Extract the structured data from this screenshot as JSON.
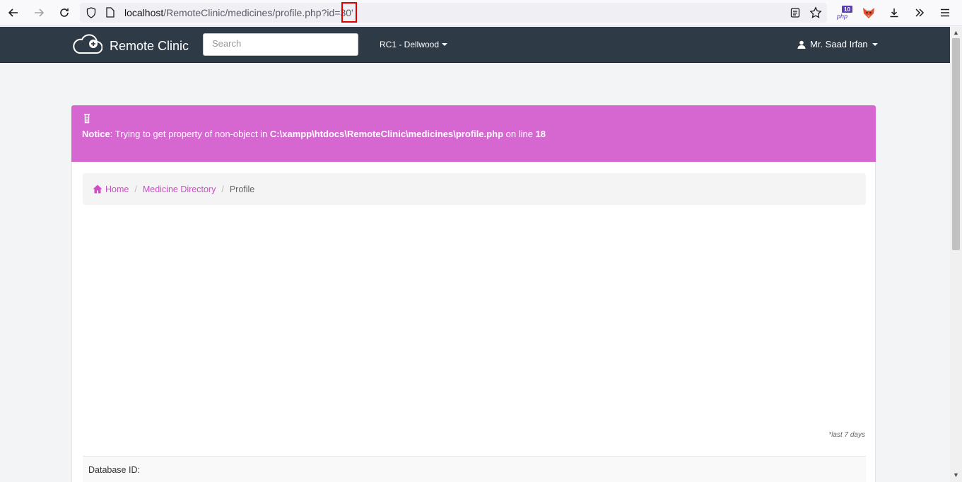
{
  "browser": {
    "url_host": "localhost",
    "url_path": "/RemoteClinic/medicines/profile.php?id=30'",
    "extension_badge": "10"
  },
  "navbar": {
    "brand": "Remote Clinic",
    "search_placeholder": "Search",
    "clinic": "RC1 - Dellwood",
    "user": "Mr. Saad Irfan"
  },
  "notice": {
    "label": "Notice",
    "message": ": Trying to get property of non-object in ",
    "path": "C:\\xampp\\htdocs\\RemoteClinic\\medicines\\profile.php",
    "on_line": " on line ",
    "line": "18"
  },
  "breadcrumb": {
    "home": "Home",
    "directory": "Medicine Directory",
    "current": "Profile"
  },
  "footnote": "*last 7 days",
  "details": {
    "database_id_label": "Database ID:"
  },
  "colors": {
    "accent": "#d667d0",
    "link": "#d14bc9",
    "navbar": "#2f3a47"
  }
}
